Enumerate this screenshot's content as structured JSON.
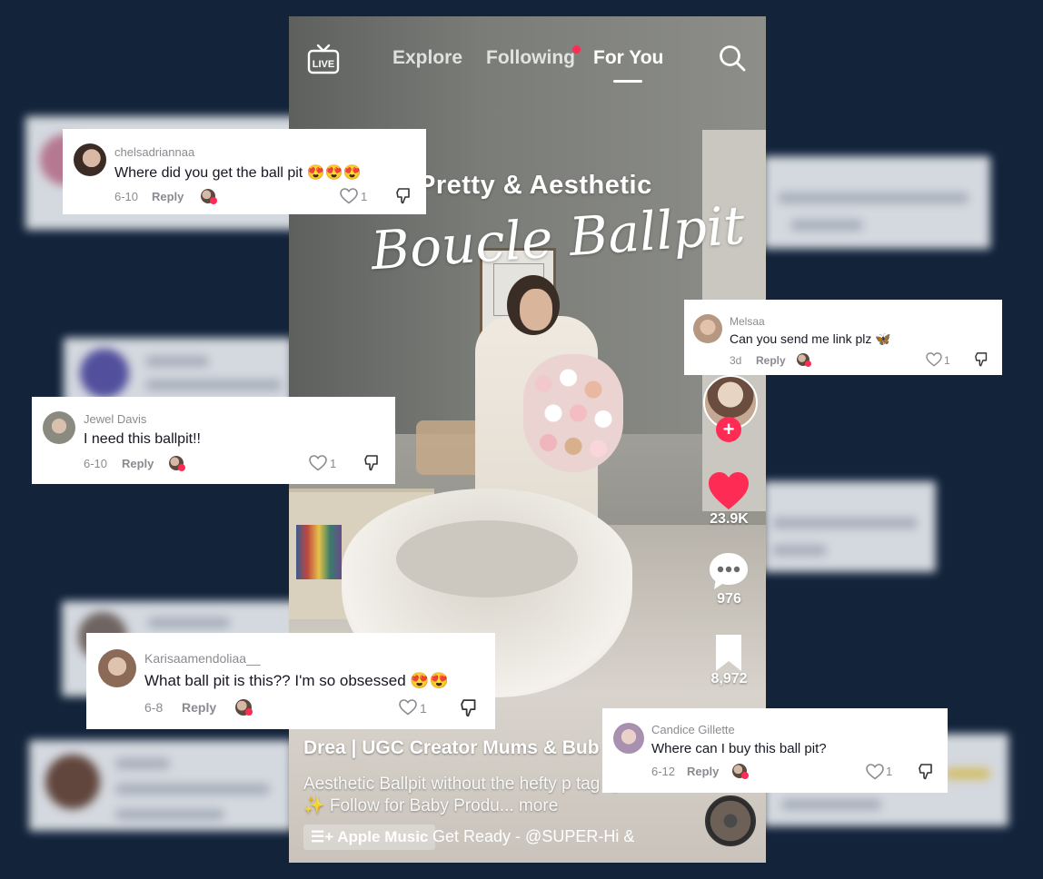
{
  "topbar": {
    "live_label": "LIVE",
    "tabs": [
      {
        "label": "Explore"
      },
      {
        "label": "Following"
      },
      {
        "label": "For You"
      }
    ]
  },
  "overlay": {
    "line1": "Pretty & Aesthetic",
    "line2": "Boucle Ballpit"
  },
  "actions": {
    "follow_symbol": "+",
    "likes": "23.9K",
    "comments": "976",
    "saves": "8,972"
  },
  "caption": {
    "author": "Drea | UGC Creator Mums & Bub",
    "text": "Aesthetic Ballpit without the hefty p tag 🤍 ✨ Follow for Baby Produ... more",
    "music_label": "Apple Music",
    "music_track": "Get Ready - @SUPER-Hi &"
  },
  "comments": [
    {
      "user": "chelsadriannaa",
      "text": "Where did you get the ball pit 😍😍😍",
      "date": "6-10",
      "reply": "Reply",
      "likes": "1"
    },
    {
      "user": "Melsaa",
      "text": "Can you send me link plz 🦋",
      "date": "3d",
      "reply": "Reply",
      "likes": "1"
    },
    {
      "user": "Jewel Davis",
      "text": "I need this ballpit!!",
      "date": "6-10",
      "reply": "Reply",
      "likes": "1"
    },
    {
      "user": "Karisaamendoliaa__",
      "text": "What ball pit is this?? I'm so obsessed 😍😍",
      "date": "6-8",
      "reply": "Reply",
      "likes": "1"
    },
    {
      "user": "Candice Gillette",
      "text": "Where can I buy this ball pit?",
      "date": "6-12",
      "reply": "Reply",
      "likes": "1"
    }
  ],
  "colors": {
    "background": "#12233a",
    "accent_red": "#fe2c55",
    "comment_text": "#161823",
    "meta_gray": "#8a8b91"
  }
}
